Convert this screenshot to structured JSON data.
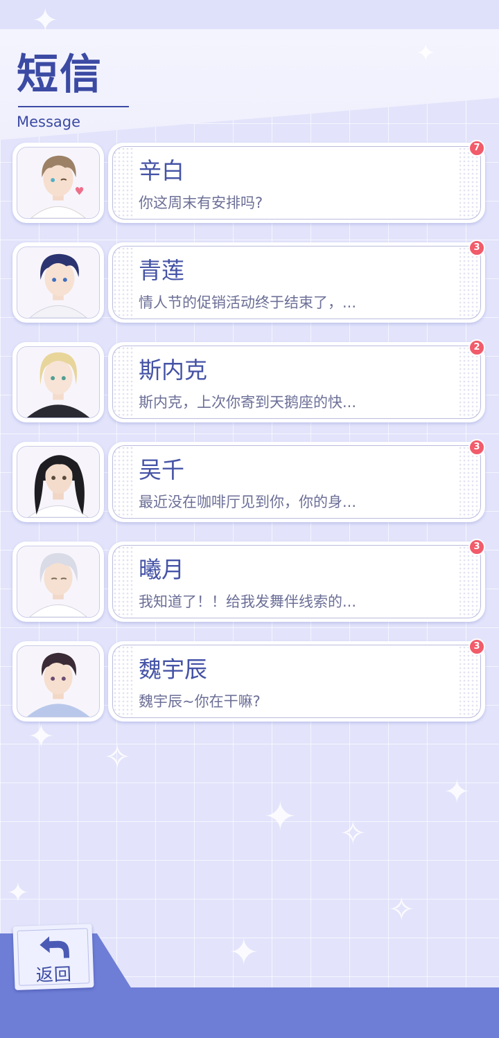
{
  "header": {
    "title": "短信",
    "subtitle": "Message"
  },
  "messages": [
    {
      "name": "辛白",
      "preview": "你这周末有安排吗?",
      "unread": "7",
      "avatar_icon": "avatar-brown-hair-wink"
    },
    {
      "name": "青莲",
      "preview": "情人节的促销活动终于结束了，...",
      "unread": "3",
      "avatar_icon": "avatar-navy-hair"
    },
    {
      "name": "斯内克",
      "preview": "斯内克，上次你寄到天鹅座的快...",
      "unread": "2",
      "avatar_icon": "avatar-blonde-hair"
    },
    {
      "name": "吴千",
      "preview": "最近没在咖啡厅见到你，你的身...",
      "unread": "3",
      "avatar_icon": "avatar-long-black-hair"
    },
    {
      "name": "曦月",
      "preview": "我知道了！！给我发舞伴线索的...",
      "unread": "3",
      "avatar_icon": "avatar-silver-hair"
    },
    {
      "name": "魏宇辰",
      "preview": "魏宇辰~你在干嘛?",
      "unread": "3",
      "avatar_icon": "avatar-dark-brown-hair"
    }
  ],
  "footer": {
    "back_label": "返回"
  },
  "colors": {
    "accent": "#3b4aa3",
    "badge": "#f15b6a",
    "bar": "#6e7ed6",
    "background": "#e3e4fb"
  }
}
